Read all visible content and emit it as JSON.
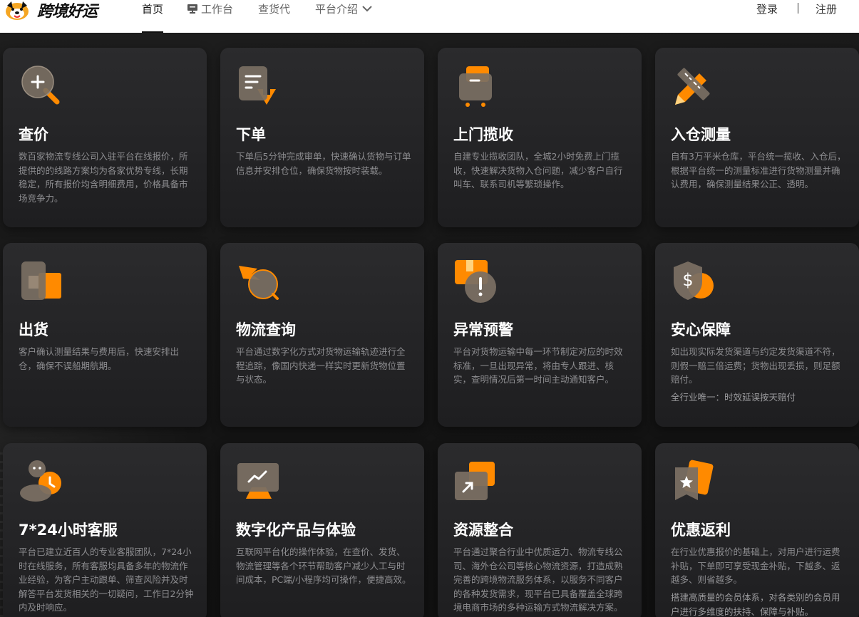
{
  "brand": {
    "name": "跨境好运"
  },
  "nav": {
    "items": [
      "首页",
      "工作台",
      "查货代",
      "平台介绍"
    ],
    "login": "登录",
    "register": "注册"
  },
  "cards": [
    {
      "icon": "search-price-icon",
      "title": "查价",
      "desc": "数百家物流专线公司入驻平台在线报价，所提供的的线路方案均为各家优势专线，长期稳定，所有报价均含明细费用，价格具备市场竞争力。"
    },
    {
      "icon": "order-icon",
      "title": "下单",
      "desc": "下单后5分钟完成审单，快速确认货物与订单信息并安排仓位，确保货物按时装载。"
    },
    {
      "icon": "pickup-icon",
      "title": "上门揽收",
      "desc": "自建专业揽收团队，全城2小时免费上门揽收，快速解决货物入仓问题，减少客户自行叫车、联系司机等繁琐操作。"
    },
    {
      "icon": "ruler-pencil-icon",
      "title": "入仓测量",
      "desc": "自有3万平米仓库，平台统一揽收、入仓后，根据平台统一的测量标准进行货物测量并确认费用，确保测量结果公正、透明。"
    },
    {
      "icon": "shipment-icon",
      "title": "出货",
      "desc": "客户确认测量结果与费用后，快速安排出仓，确保不误船期航期。"
    },
    {
      "icon": "tracking-icon",
      "title": "物流查询",
      "desc": "平台通过数字化方式对货物运输轨迹进行全程追踪，像国内快递一样实时更新货物位置与状态。"
    },
    {
      "icon": "warning-icon",
      "title": "异常预警",
      "desc": "平台对货物运输中每一环节制定对应的时效标准，一旦出现异常，将由专人跟进、核实，查明情况后第一时间主动通知客户。"
    },
    {
      "icon": "shield-dollar-icon",
      "title": "安心保障",
      "desc": "如出现实际发货渠道与约定发货渠道不符，则假一赔三倍运费；货物出现丢损，则足额赔付。",
      "extra": "全行业唯一：时效延误按天赔付"
    },
    {
      "icon": "customer-service-icon",
      "title": "7*24小时客服",
      "desc": "平台已建立近百人的专业客服团队，7*24小时在线服务，所有客服均具备多年的物流作业经验，为客户主动跟单、筛查风险并及时解答平台发货相关的一切疑问，工作日2分钟内及时响应。"
    },
    {
      "icon": "digital-chart-icon",
      "title": "数字化产品与体验",
      "desc": "互联网平台化的操作体验，在查价、发货、物流管理等各个环节帮助客户减少人工与时间成本，PC端/小程序均可操作，便捷高效。"
    },
    {
      "icon": "resource-icon",
      "title": "资源整合",
      "desc": "平台通过聚合行业中优质运力、物流专线公司、海外仓公司等核心物流资源，打造成熟完善的跨境物流服务体系，以服务不同客户的各种发货需求，现平台已具备覆盖全球跨境电商市场的多种运输方式物流解决方案。"
    },
    {
      "icon": "coupon-star-icon",
      "title": "优惠返利",
      "desc": "在行业优惠报价的基础上，对用户进行运费补贴，下单即可享受现金补贴，下越多、返越多、则省越多。",
      "extra": "搭建高质量的会员体系，对各类别的会员用户进行多维度的扶持、保障与补贴。"
    }
  ]
}
